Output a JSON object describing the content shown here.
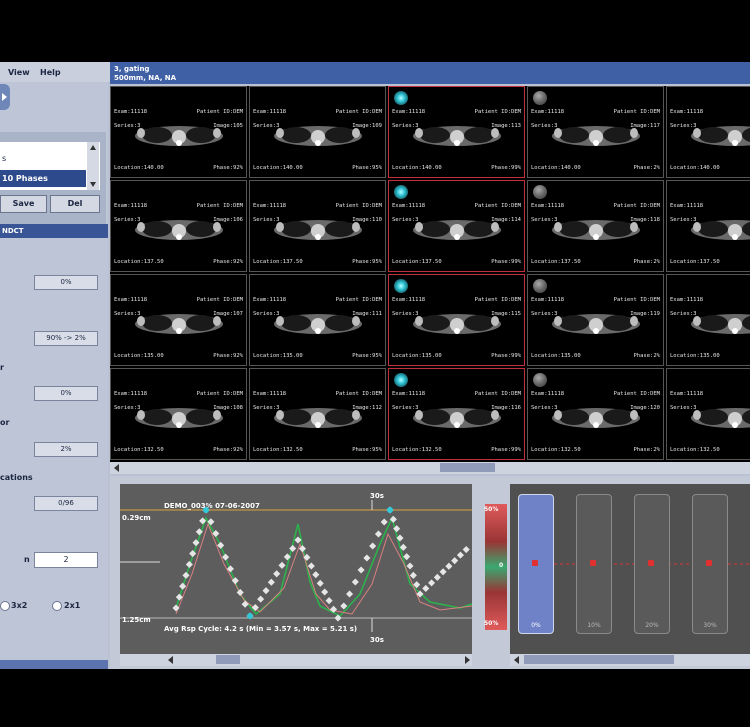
{
  "menu": {
    "view": "View",
    "help": "Help"
  },
  "left_panel": {
    "list_items": [
      "s",
      "10 Phases"
    ],
    "save_label": "Save",
    "del_label": "Del",
    "section_header": "NDCT",
    "fields": [
      "0%",
      "90% -> 2%",
      "0%",
      "2%",
      "0/96"
    ],
    "labels": {
      "r": "r",
      "or": "or",
      "cations": "cations",
      "n": "n"
    },
    "input_value": "2",
    "radio_3x2": "3x2",
    "radio_2x1": "2x1",
    "footer_value": "0%"
  },
  "viewer": {
    "title_line1": "3, gating",
    "title_line2": "500mm, NA, NA"
  },
  "grid": {
    "exam_text": "Exam:11118",
    "patient_text": "Patient ID:DEM",
    "series_text": "Series:3",
    "image_prefix": "Image:",
    "location_prefix": "Location:",
    "phase_prefix": "Phase:",
    "phases": [
      "92%",
      "95%",
      "99%",
      "2%",
      "5%"
    ],
    "locations": [
      "140.00",
      "137.50",
      "135.00",
      "132.50"
    ],
    "images": [
      [
        105,
        109,
        113,
        117,
        121
      ],
      [
        106,
        110,
        114,
        118,
        122
      ],
      [
        107,
        111,
        115,
        119,
        123
      ],
      [
        108,
        112,
        116,
        120,
        124
      ]
    ]
  },
  "resp_chart": {
    "label": "DEMO_003% 07-06-2007",
    "top_value": "0.29cm",
    "bottom_value": "1.25cm",
    "time_label": "30s",
    "stats": "Avg Rsp Cycle: 4.2 s (Min = 3.57 s, Max = 5.21 s)"
  },
  "color_scale": {
    "top": "50%",
    "mid": "0",
    "bottom": "50%"
  },
  "phase_columns": [
    "0%",
    "10%",
    "20%",
    "30%"
  ],
  "colors": {
    "panel_blue": "#3a5596",
    "title_blue": "#4060a6",
    "selected_border": "#c0303a",
    "green_curve": "#2bb24c",
    "dot_color": "#e6e6e6",
    "marker_red": "#e03030"
  }
}
